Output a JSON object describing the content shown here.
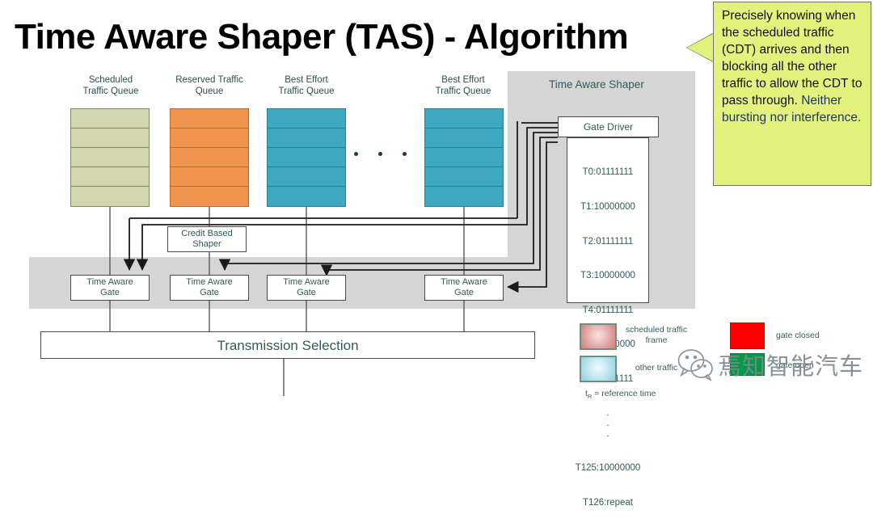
{
  "title": "Time Aware Shaper (TAS) - Algorithm",
  "diagram": {
    "queues": [
      {
        "label_line1": "Scheduled",
        "label_line2": "Traffic Queue",
        "color": "#d3d5ae",
        "segments": 5
      },
      {
        "label_line1": "Reserved Traffic",
        "label_line2": "Queue",
        "color": "#f0934e",
        "segments": 5
      },
      {
        "label_line1": "Best Effort",
        "label_line2": "Traffic Queue",
        "color": "#3ea8c0",
        "segments": 5
      },
      {
        "label_line1": "Best Effort",
        "label_line2": "Traffic Queue",
        "color": "#3ea8c0",
        "segments": 5
      }
    ],
    "ellipsis_dots": 3,
    "tas_panel_title": "Time Aware Shaper",
    "credit_based_shaper": "Credit Based\nShaper",
    "gate_driver": "Gate Driver",
    "gates": [
      "Time Aware\nGate",
      "Time Aware\nGate",
      "Time Aware\nGate",
      "Time Aware\nGate"
    ],
    "transmission_selection": "Transmission Selection",
    "schedule": {
      "entries": [
        "T0:01111111",
        "T1:10000000",
        "T2:01111111",
        "T3:10000000",
        "T4:01111111",
        "T5:10000000",
        "T6:01111111"
      ],
      "ellipsis": ".\n.\n.",
      "tail": [
        "T125:10000000",
        "T126:repeat"
      ]
    }
  },
  "callout": {
    "body": "Precisely knowing when the scheduled traffic (CDT) arrives and then blocking all the other traffic to allow the CDT to pass through. ",
    "accent": "Neither bursting nor interference.",
    "background": "#e2f27c",
    "accent_color": "#1f3864"
  },
  "legend": {
    "items": [
      {
        "name": "scheduled-traffic-frame",
        "label": "scheduled traffic\nframe",
        "swatch": "#d88b88"
      },
      {
        "name": "other-traffic",
        "label": "other traffic",
        "swatch": "#a8dced"
      },
      {
        "name": "gate-closed",
        "label": "gate closed",
        "swatch": "#fc0000"
      },
      {
        "name": "gate-open",
        "label": "gate open",
        "swatch": "#009a44"
      }
    ],
    "note_symbol": "t",
    "note_sub": "R",
    "note_text": " = reference time"
  },
  "watermark": {
    "text": "焉知智能汽车"
  }
}
